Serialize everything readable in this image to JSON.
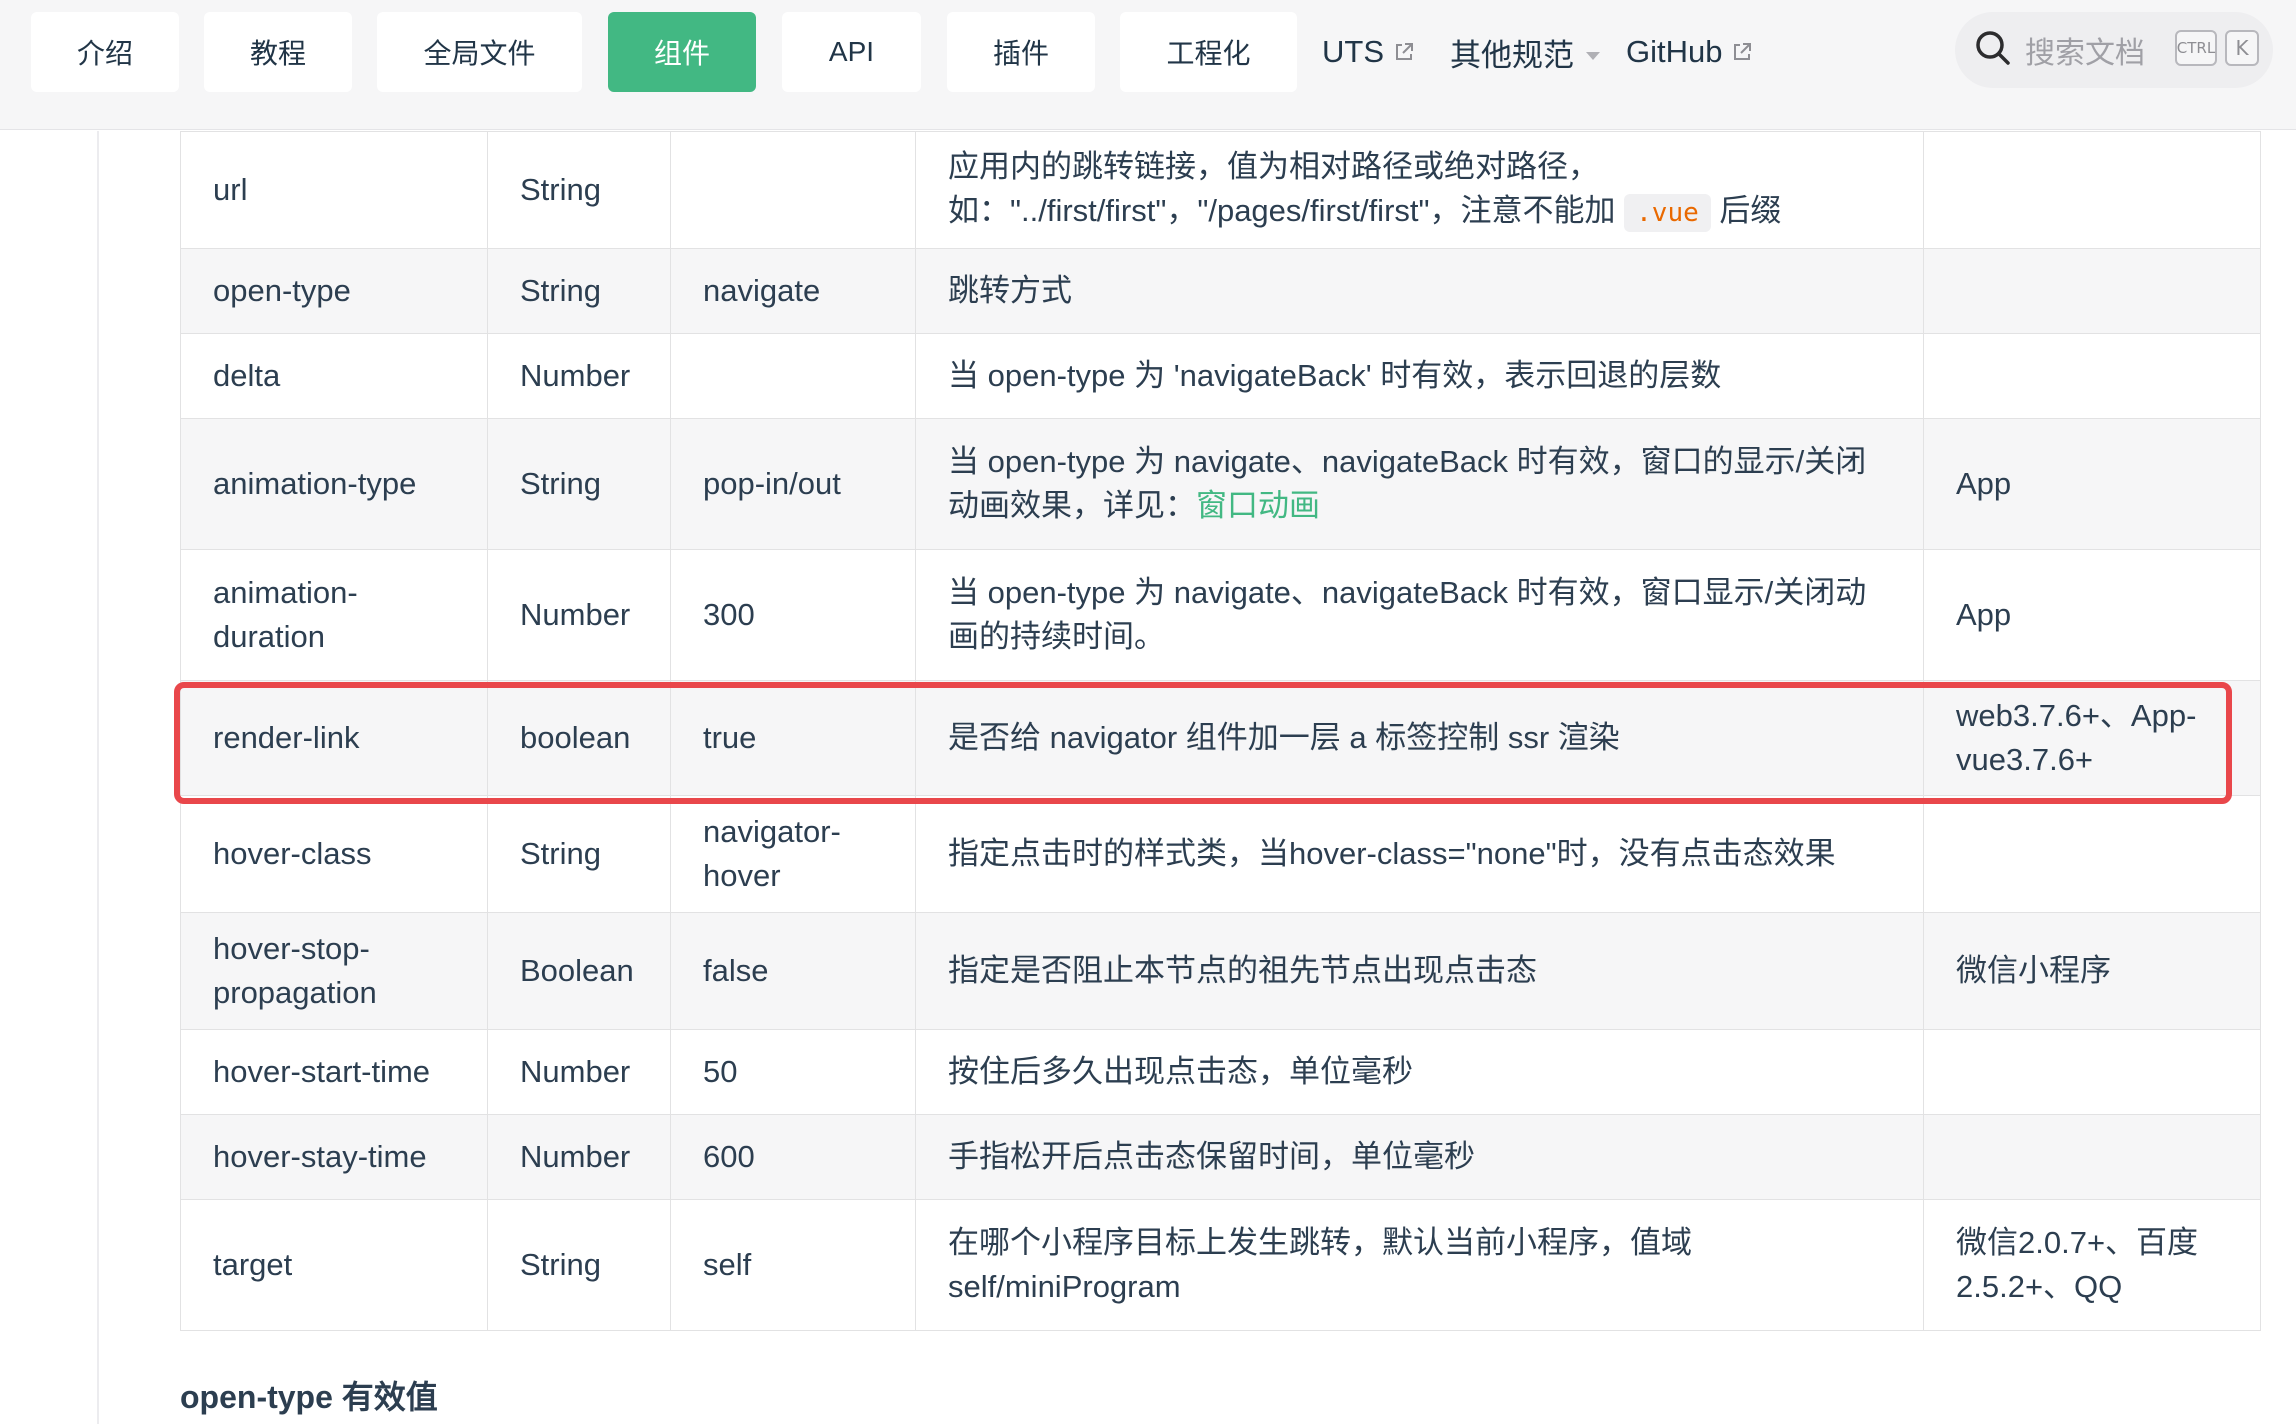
{
  "nav": {
    "tabs": [
      "介绍",
      "教程",
      "全局文件",
      "组件",
      "API",
      "插件",
      "工程化"
    ],
    "links": [
      {
        "label": "UTS",
        "icon": "external-link-icon"
      },
      {
        "label": "其他规范",
        "icon": "caret-down-icon"
      },
      {
        "label": "GitHub",
        "icon": "external-link-icon"
      }
    ],
    "active_tab": "组件",
    "accent_color": "#42b883"
  },
  "search": {
    "placeholder": "搜索文档",
    "kbd_ctrl": "CTRL",
    "kbd_k": "K"
  },
  "table": {
    "rows": [
      {
        "name": "url",
        "type": "String",
        "default": "",
        "desc_1": "应用内的跳转链接，值为相对路径或绝对路径，",
        "desc_2a": "如：\"../first/first\"，\"/pages/first/first\"，注意不能加 ",
        "desc_code": ".vue",
        "desc_2b": " 后缀",
        "platform": ""
      },
      {
        "name": "open-type",
        "type": "String",
        "default": "navigate",
        "desc": "跳转方式",
        "platform": ""
      },
      {
        "name": "delta",
        "type": "Number",
        "default": "",
        "desc": "当 open-type 为 'navigateBack' 时有效，表示回退的层数",
        "platform": ""
      },
      {
        "name": "animation-type",
        "type": "String",
        "default": "pop-in/out",
        "desc_prefix": "当 open-type 为 navigate、navigateBack 时有效，窗口的显示/关闭动画效果，详见：",
        "desc_link": "窗口动画",
        "platform": "App"
      },
      {
        "name": "animation-duration",
        "type": "Number",
        "default": "300",
        "desc": "当 open-type 为 navigate、navigateBack 时有效，窗口显示/关闭动画的持续时间。",
        "platform": "App"
      },
      {
        "name": "render-link",
        "type": "boolean",
        "default": "true",
        "desc": "是否给 navigator 组件加一层 a 标签控制 ssr 渲染",
        "platform": "web3.7.6+、App-vue3.7.6+"
      },
      {
        "name": "hover-class",
        "type": "String",
        "default": "navigator-hover",
        "desc": "指定点击时的样式类，当hover-class=\"none\"时，没有点击态效果",
        "platform": ""
      },
      {
        "name": "hover-stop-propagation",
        "type": "Boolean",
        "default": "false",
        "desc": "指定是否阻止本节点的祖先节点出现点击态",
        "platform": "微信小程序"
      },
      {
        "name": "hover-start-time",
        "type": "Number",
        "default": "50",
        "desc": "按住后多久出现点击态，单位毫秒",
        "platform": ""
      },
      {
        "name": "hover-stay-time",
        "type": "Number",
        "default": "600",
        "desc": "手指松开后点击态保留时间，单位毫秒",
        "platform": ""
      },
      {
        "name": "target",
        "type": "String",
        "default": "self",
        "desc": "在哪个小程序目标上发生跳转，默认当前小程序，值域self/miniProgram",
        "platform": "微信2.0.7+、百度2.5.2+、QQ"
      }
    ]
  },
  "section_heading": "open-type 有效值",
  "highlight_color": "#e9474b"
}
